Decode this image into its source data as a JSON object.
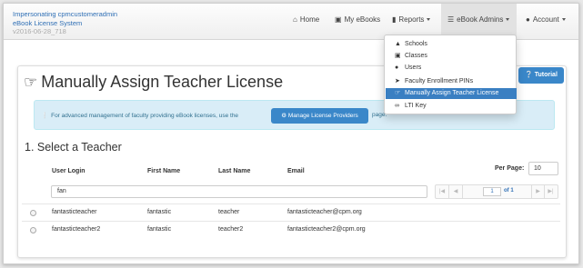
{
  "brand": {
    "line1": "Impersonating cpmcustomeradmin",
    "line2": "eBook License System",
    "version": "v2016-06-28_718"
  },
  "nav": {
    "home": "Home",
    "my_ebooks": "My eBooks",
    "reports": "Reports",
    "ebook_admins": "eBook Admins",
    "account": "Account"
  },
  "dropdown": {
    "items": [
      {
        "label": "Schools",
        "icon": "graduation-cap-icon"
      },
      {
        "label": "Classes",
        "icon": "book-icon"
      },
      {
        "label": "Users",
        "icon": "user-icon"
      },
      {
        "label": "Faculty Enrollment PINs",
        "icon": "sign-in-icon"
      },
      {
        "label": "Manually Assign Teacher License",
        "icon": "hand-pointer-icon"
      },
      {
        "label": "LTI Key",
        "icon": "link-icon"
      }
    ]
  },
  "page": {
    "title": "Manually Assign Teacher License",
    "tutorial_label": "Tutorial",
    "alert_text": "For advanced management of faculty providing eBook licenses, use the",
    "alert_button": "Manage License Providers",
    "alert_tail": "page.",
    "section_title": "1. Select a Teacher"
  },
  "table": {
    "headers": [
      "User Login",
      "First Name",
      "Last Name",
      "Email"
    ],
    "per_page_label": "Per Page:",
    "per_page_value": "10",
    "filter_value": "fan",
    "pager": {
      "current": "1",
      "of_label": "of 1"
    },
    "rows": [
      {
        "login": "fantasticteacher",
        "first": "fantastic",
        "last": "teacher",
        "email": "fantasticteacher@cpm.org"
      },
      {
        "login": "fantasticteacher2",
        "first": "fantastic",
        "last": "teacher2",
        "email": "fantasticteacher2@cpm.org"
      }
    ]
  },
  "colors": {
    "accent": "#3a87c9",
    "alert_bg": "#d9edf7",
    "link": "#2f6fb5"
  }
}
